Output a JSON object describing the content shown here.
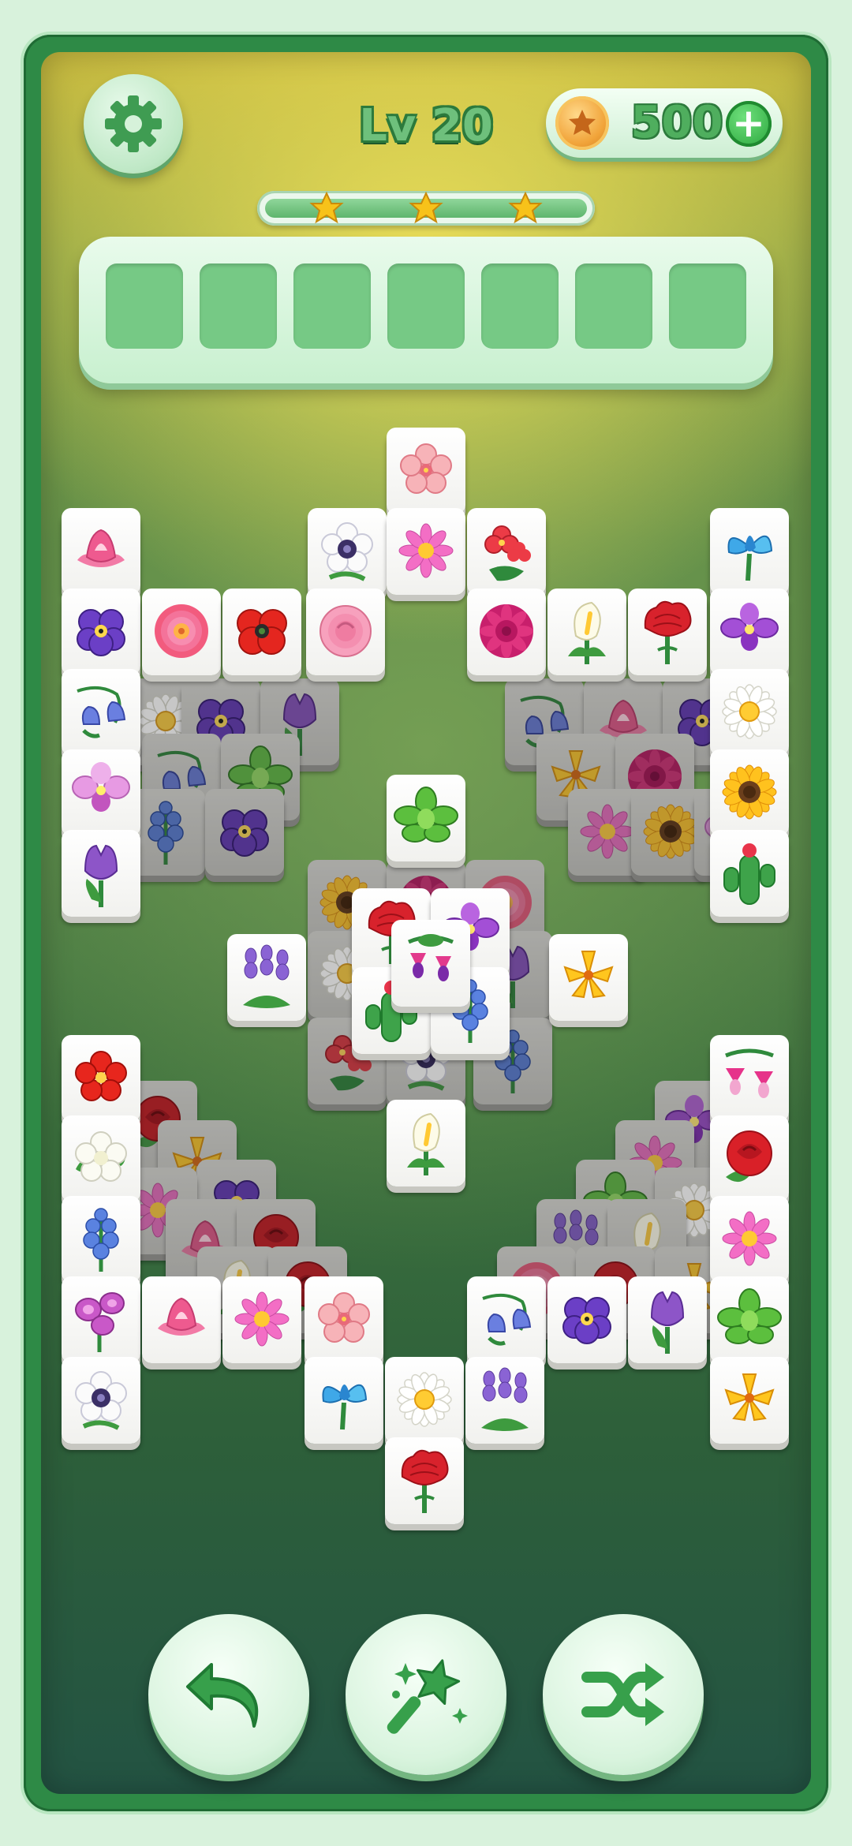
{
  "header": {
    "level_label": "Lv 20",
    "coins": "500",
    "settings_icon": "gear-icon",
    "coin_icon": "coin-star-icon",
    "add_coins_icon": "plus-icon"
  },
  "progress": {
    "stars_total": 3,
    "fill_fraction": 1.0
  },
  "slot_tray": {
    "slot_count": 7,
    "filled": 0
  },
  "tiles": {
    "top_layer": [
      "pink-cherry-blossom",
      "white-anemone",
      "pink-daisy",
      "red-begonia",
      "pink-lotus",
      "blue-iris",
      "purple-pansy",
      "pink-zinnia",
      "red-poppy",
      "pink-peony",
      "magenta-dahlia",
      "white-calla-lily",
      "red-carnation",
      "purple-orchid",
      "blue-bellflower",
      "white-daisy",
      "pink-orchid",
      "sunflower",
      "purple-tulip",
      "cactus-flower",
      "green-succulent",
      "purple-lavender",
      "yellow-lily",
      "fuchsia",
      "white-calla-lily",
      "red-hibiscus",
      "pink-fuchsia",
      "white-gardenia",
      "red-rose",
      "blue-delphinium",
      "pink-daisy",
      "pink-sweet-pea",
      "pink-lotus",
      "pink-daisy",
      "pink-cherry-blossom",
      "blue-bellflower",
      "purple-pansy",
      "purple-tulip",
      "green-succulent",
      "white-anemone",
      "blue-iris",
      "white-daisy",
      "purple-lavender",
      "yellow-lily",
      "red-carnation"
    ]
  },
  "toolbar": {
    "undo_icon": "undo-icon",
    "hint_icon": "magic-wand-icon",
    "shuffle_icon": "shuffle-icon"
  },
  "colors": {
    "frame": "#2e8a46",
    "accent_green": "#4fae5e",
    "coin_gold": "#f1a43a",
    "star_gold": "#f7c21a",
    "slot_green": "#76c985"
  }
}
